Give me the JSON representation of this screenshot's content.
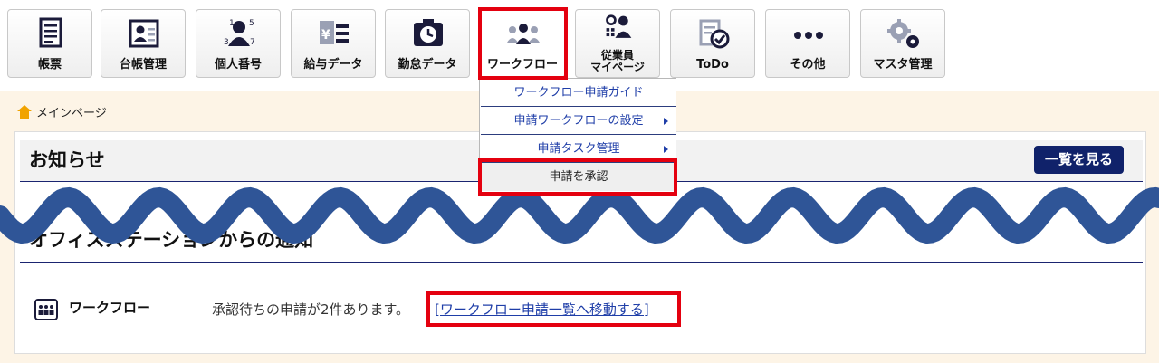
{
  "toolbar": {
    "items": [
      {
        "label": "帳票",
        "icon": "document-list-icon"
      },
      {
        "label": "台帳管理",
        "icon": "id-card-icon"
      },
      {
        "label": "個人番号",
        "icon": "person-number-icon"
      },
      {
        "label": "給与データ",
        "icon": "salary-yen-icon"
      },
      {
        "label": "勤怠データ",
        "icon": "attendance-clock-icon"
      },
      {
        "label": "ワークフロー",
        "icon": "workflow-people-icon"
      },
      {
        "label_line1": "従業員",
        "label_line2": "マイページ",
        "icon": "employee-mypage-icon"
      },
      {
        "label": "ToDo",
        "icon": "todo-check-icon"
      },
      {
        "label": "その他",
        "icon": "more-dots-icon"
      },
      {
        "label": "マスタ管理",
        "icon": "gears-icon"
      }
    ]
  },
  "dropdown": {
    "items": [
      {
        "label": "ワークフロー申請ガイド"
      },
      {
        "label": "申請ワークフローの設定"
      },
      {
        "label": "申請タスク管理"
      },
      {
        "label": "申請を承認"
      }
    ]
  },
  "breadcrumb": {
    "label": "メインページ",
    "icon": "home-icon"
  },
  "notices": {
    "title": "お知らせ",
    "more_button": "一覧を見る",
    "section_title": "オフィスステーションからの通知",
    "row": {
      "category": "ワークフロー",
      "message": "承認待ちの申請が2件あります。",
      "link": "[ワークフロー申請一覧へ移動する]"
    }
  },
  "colors": {
    "highlight_red": "#e4000f",
    "navy": "#10226a",
    "link_blue": "#1f3ea8",
    "wave_blue": "#2f5597",
    "content_bg": "#fdf4e6"
  }
}
